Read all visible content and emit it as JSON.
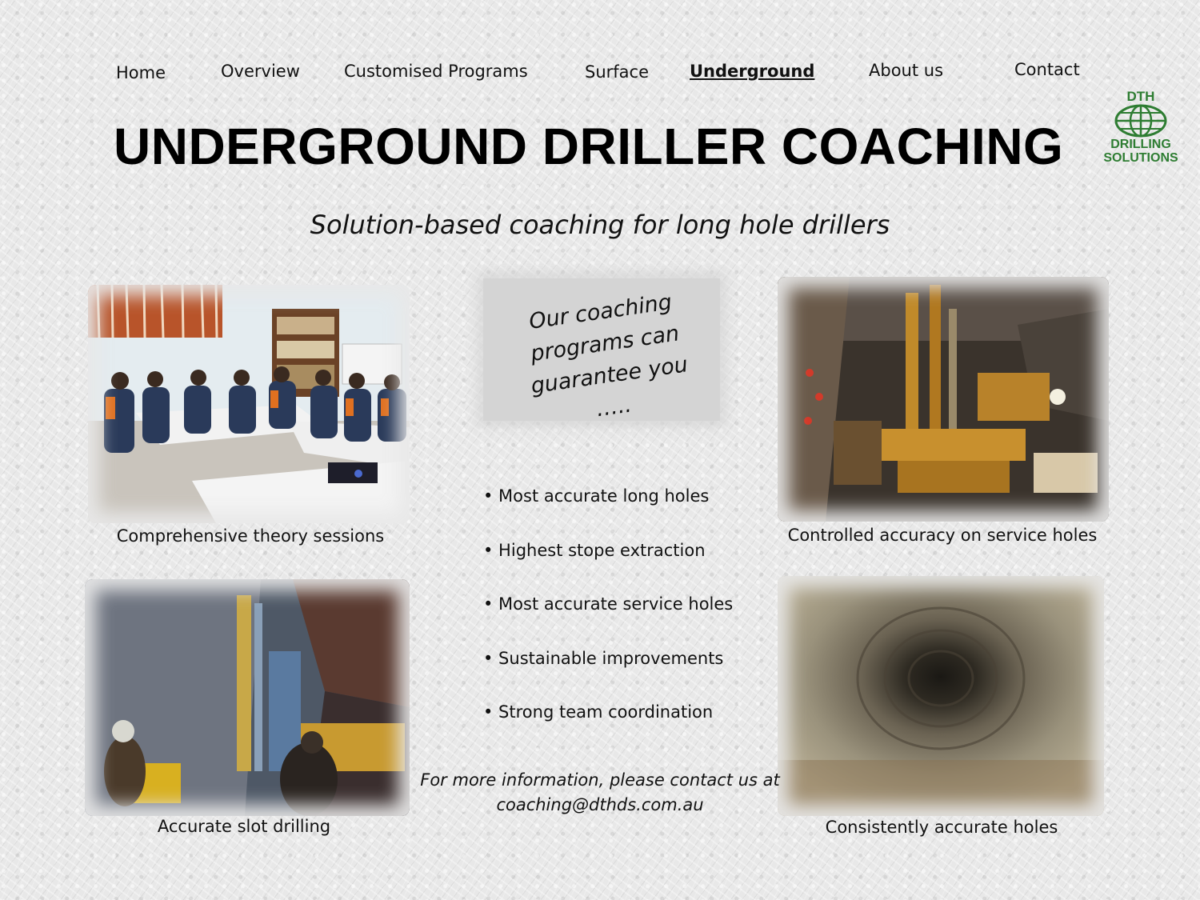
{
  "nav": {
    "home": "Home",
    "overview": "Overview",
    "customised": "Customised Programs",
    "surface": "Surface",
    "underground": "Underground",
    "about": "About us",
    "contact": "Contact"
  },
  "header": {
    "title": "UNDERGROUND DRILLER COACHING",
    "subtitle": "Solution-based coaching for long hole drillers"
  },
  "logo": {
    "line1": "DTH",
    "line2": "DRILLING",
    "line3": "SOLUTIONS"
  },
  "photos": {
    "theory": "Comprehensive theory sessions",
    "service": "Controlled accuracy on service holes",
    "slot": "Accurate slot drilling",
    "holes": "Consistently accurate holes"
  },
  "callout": {
    "line1": "Our coaching",
    "line2": "programs can",
    "line3": "guarantee you ….."
  },
  "benefits": [
    "• Most accurate long holes",
    "• Highest stope extraction",
    "• Most accurate service holes",
    "• Sustainable improvements",
    "• Strong team coordination"
  ],
  "contact": {
    "line1": "For more information, please contact us at",
    "email": "coaching@dthds.com.au"
  },
  "colors": {
    "logo_green": "#2e7d32",
    "callout_bg": "#d4d4d4"
  }
}
